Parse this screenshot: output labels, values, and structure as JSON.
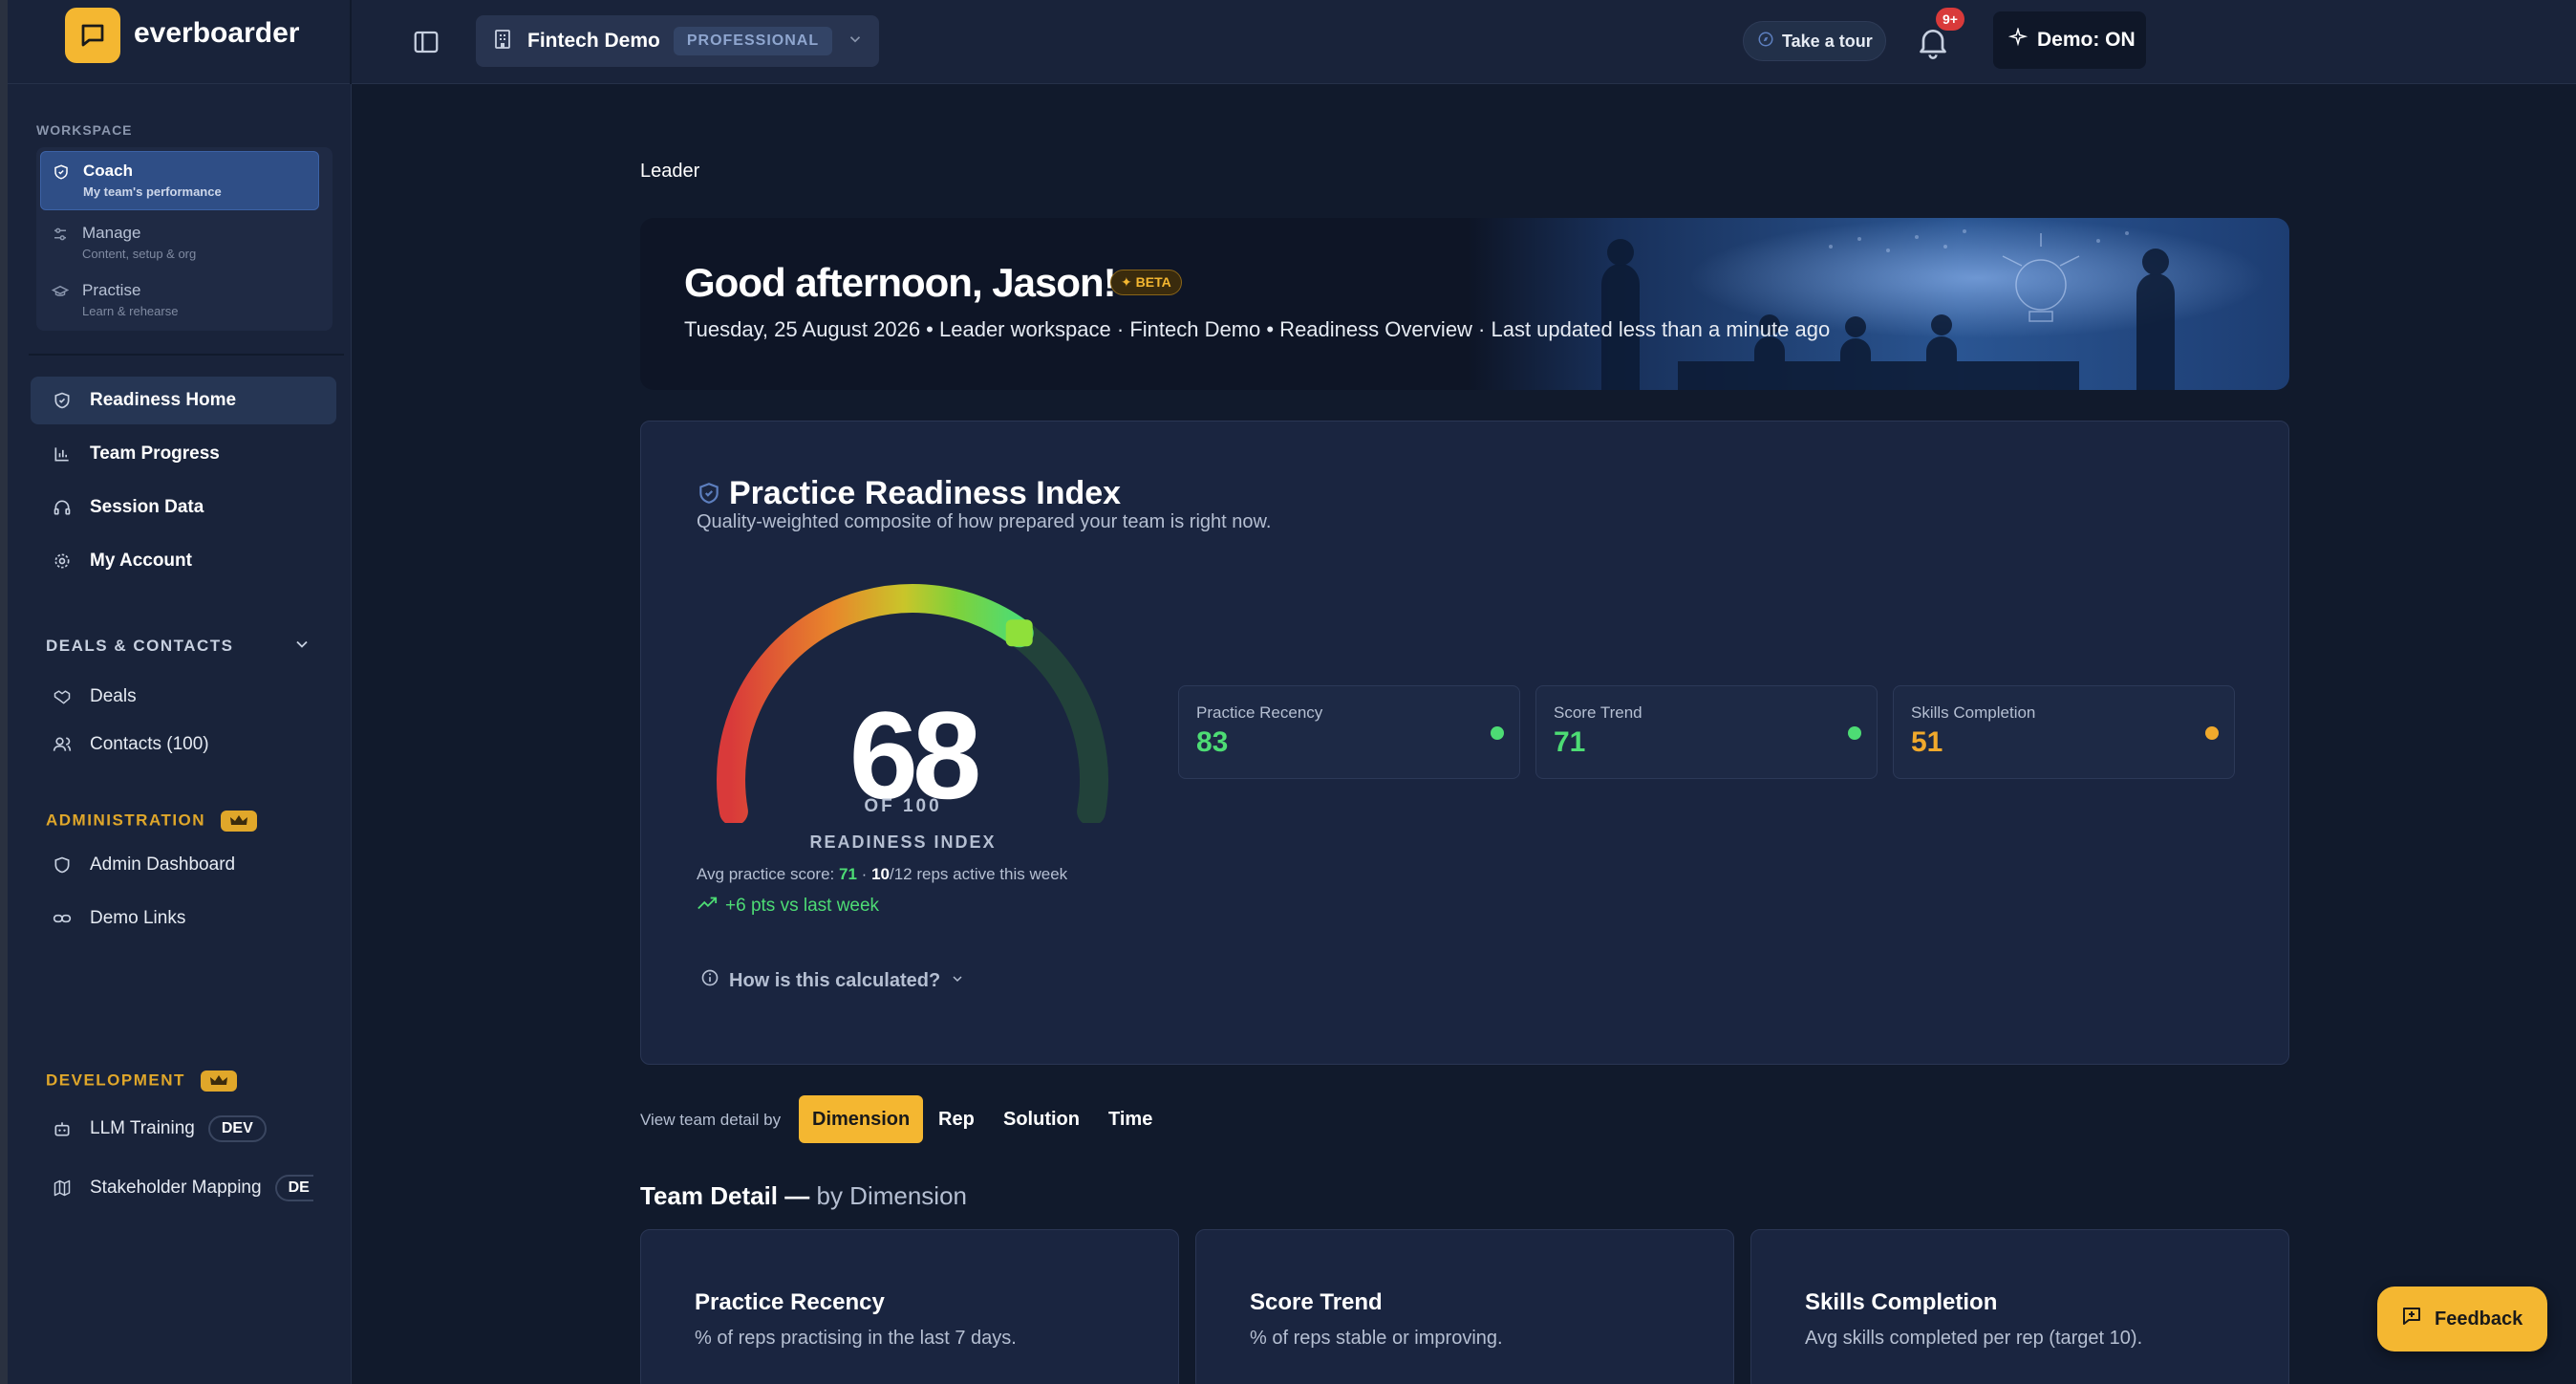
{
  "brand": {
    "name": "everboarder"
  },
  "header": {
    "org_name": "Fintech Demo",
    "plan_badge": "PROFESSIONAL",
    "tour_label": "Take a tour",
    "notif_badge": "9+",
    "demo_label": "Demo: ON"
  },
  "sidebar": {
    "workspace_label": "WORKSPACE",
    "workspace_items": [
      {
        "title": "Coach",
        "sub": "My team's performance"
      },
      {
        "title": "Manage",
        "sub": "Content, setup & org"
      },
      {
        "title": "Practise",
        "sub": "Learn & rehearse"
      }
    ],
    "nav": [
      {
        "label": "Readiness Home"
      },
      {
        "label": "Team Progress"
      },
      {
        "label": "Session Data"
      },
      {
        "label": "My Account"
      }
    ],
    "deals_section": "DEALS & CONTACTS",
    "deals_items": [
      {
        "label": "Deals"
      },
      {
        "label": "Contacts (100)"
      }
    ],
    "admin_section": "ADMINISTRATION",
    "admin_items": [
      {
        "label": "Admin Dashboard"
      },
      {
        "label": "Demo Links"
      }
    ],
    "dev_section": "DEVELOPMENT",
    "dev_items": [
      {
        "label": "LLM Training",
        "pill": "DEV"
      },
      {
        "label": "Stakeholder Mapping",
        "pill": "DE"
      }
    ]
  },
  "main": {
    "breadcrumb": "Leader",
    "hero": {
      "greeting": "Good afternoon, Jason!",
      "beta": "BETA",
      "subtitle": "Tuesday, 25 August 2026 • Leader workspace · Fintech Demo • Readiness Overview · Last updated less than a minute ago"
    },
    "readiness": {
      "title": "Practice Readiness Index",
      "subtitle": "Quality-weighted composite of how prepared your team is right now.",
      "score": 68,
      "score_text": "68",
      "of_label": "OF 100",
      "index_label": "READINESS INDEX",
      "avg_prefix": "Avg practice score:",
      "avg_score": "71",
      "sep": "·",
      "reps_active": "10",
      "reps_total": "/12",
      "reps_suffix": "reps active this week",
      "trend": "+6 pts vs last week",
      "how_calc": "How is this calculated?",
      "metrics": [
        {
          "label": "Practice Recency",
          "value": "83",
          "color": "#4ddc74"
        },
        {
          "label": "Score Trend",
          "value": "71",
          "color": "#4ddc74"
        },
        {
          "label": "Skills Completion",
          "value": "51",
          "color": "#f0a92c"
        }
      ]
    },
    "view_by": {
      "label": "View team detail by",
      "options": [
        "Dimension",
        "Rep",
        "Solution",
        "Time"
      ],
      "active": "Dimension"
    },
    "team_detail": {
      "title": "Team Detail —",
      "suffix": "by Dimension",
      "cards": [
        {
          "title": "Practice Recency",
          "desc": "% of reps practising in the last 7 days."
        },
        {
          "title": "Score Trend",
          "desc": "% of reps stable or improving."
        },
        {
          "title": "Skills Completion",
          "desc": "Avg skills completed per rep (target 10)."
        }
      ]
    },
    "feedback_label": "Feedback"
  }
}
